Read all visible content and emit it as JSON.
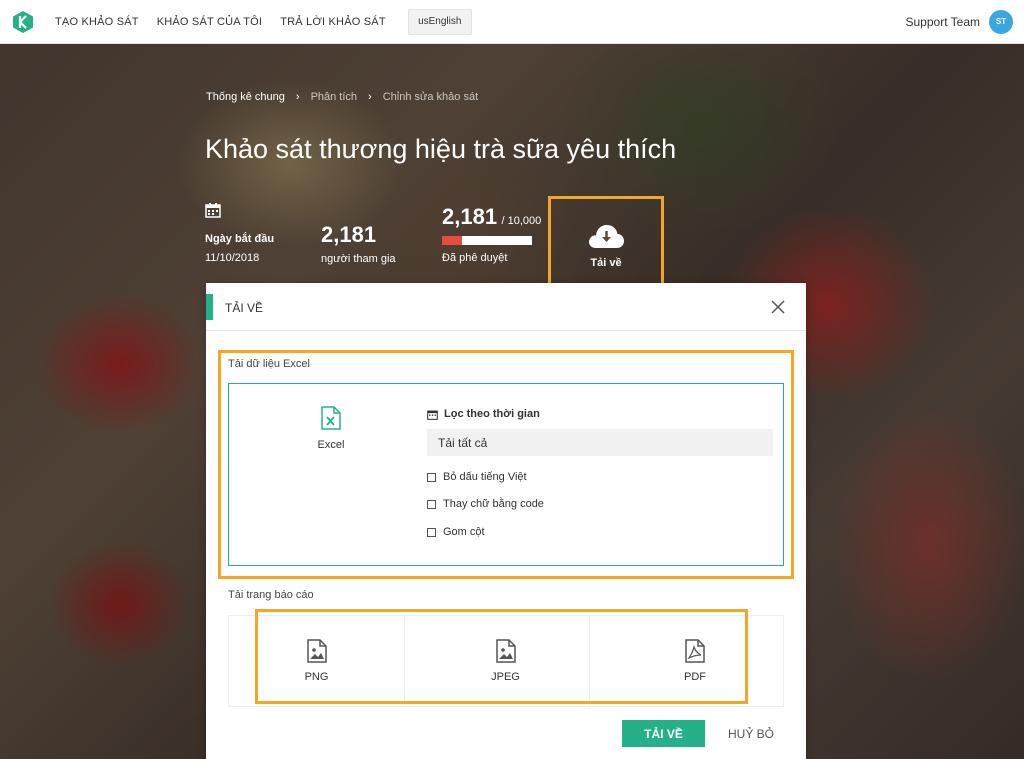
{
  "nav": {
    "items": [
      {
        "label": "TẠO KHẢO SÁT"
      },
      {
        "label": "KHẢO SÁT CỦA TÔI"
      },
      {
        "label": "TRẢ LỜI KHẢO SÁT"
      }
    ],
    "language_button": "usEnglish",
    "user_name": "Support Team",
    "avatar_initials": "ST",
    "logo_icon": "k-logo-icon"
  },
  "breadcrumb": {
    "items": [
      {
        "label": "Thống kê chung"
      },
      {
        "label": "Phân tích"
      },
      {
        "label": "Chỉnh sửa khảo sát"
      }
    ]
  },
  "page": {
    "title": "Khảo sát thương hiệu trà sữa yêu thích"
  },
  "stats": {
    "start": {
      "label": "Ngày bắt đầu",
      "value": "11/10/2018",
      "icon": "calendar-icon"
    },
    "participants": {
      "value": "2,181",
      "label": "người tham gia"
    },
    "approved": {
      "value": "2,181",
      "total": "/ 10,000",
      "label": "Đã phê duyệt",
      "progress": 0.2181
    },
    "download": {
      "label": "Tải về",
      "icon": "cloud-download-icon"
    }
  },
  "modal": {
    "title": "TẢI VỀ",
    "excel_section_label": "Tải dữ liệu Excel",
    "excel_label": "Excel",
    "filter_title": "Lọc theo thời gian",
    "filter_value": "Tải tất cả",
    "options": [
      {
        "label": "Bỏ dấu tiếng Việt",
        "checked": false
      },
      {
        "label": "Thay chữ bằng code",
        "checked": false
      },
      {
        "label": "Gom cột",
        "checked": false
      }
    ],
    "report_section_label": "Tải trang báo cáo",
    "report_formats": [
      {
        "label": "PNG",
        "icon": "image-file-icon"
      },
      {
        "label": "JPEG",
        "icon": "image-file-icon"
      },
      {
        "label": "PDF",
        "icon": "pdf-file-icon"
      }
    ],
    "download_button": "TẢI VỀ",
    "cancel_button": "HUỶ BỎ"
  },
  "colors": {
    "accent": "#26b08a",
    "highlight": "#f5a623",
    "progress_fill": "#e74c3c",
    "avatar": "#3aa8e0"
  }
}
